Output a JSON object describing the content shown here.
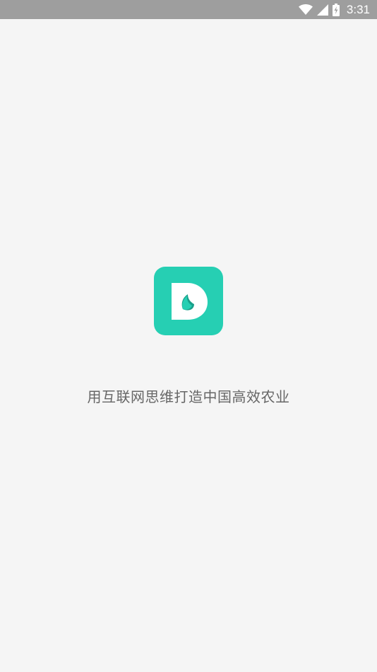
{
  "status_bar": {
    "time": "3:31",
    "icons": [
      "wifi-icon",
      "cell-signal-icon",
      "battery-charging-icon"
    ]
  },
  "splash": {
    "logo_icon": "app-logo-d-leaf-icon",
    "logo_color": "#26cfb3",
    "slogan": "用互联网思维打造中国高效农业"
  },
  "colors": {
    "status_bar_bg": "#9e9e9e",
    "background": "#f5f5f5",
    "slogan_text": "#666666"
  }
}
